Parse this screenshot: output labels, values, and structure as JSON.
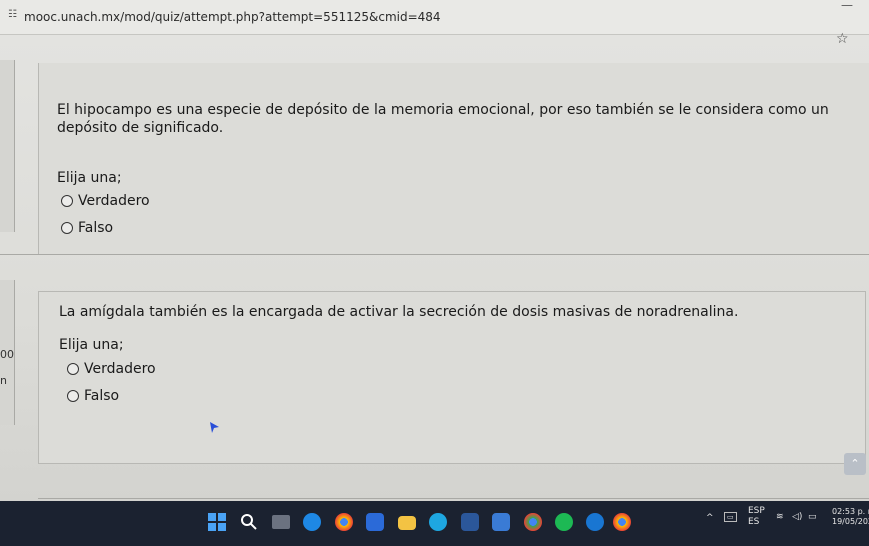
{
  "browser": {
    "url": "mooc.unach.mx/mod/quiz/attempt.php?attempt=551125&cmid=484"
  },
  "questions": [
    {
      "text": "El hipocampo es una especie de depósito de la memoria emocional, por eso también se le considera como un depósito de significado.",
      "prompt": "Elija una;",
      "options": [
        "Verdadero",
        "Falso"
      ]
    },
    {
      "text": "La amígdala también es la encargada de activar la secreción de dosis masivas de noradrenalina.",
      "prompt": "Elija una;",
      "options": [
        "Verdadero",
        "Falso"
      ]
    }
  ],
  "sidebar_fragments": [
    "00",
    "n"
  ],
  "taskbar": {
    "language_top": "ESP",
    "language_bottom": "ES",
    "time": "02:53 p. m.",
    "date": "19/05/2024",
    "icons": [
      "start-icon",
      "search-icon",
      "task-view-icon",
      "edge-icon",
      "chrome-icon",
      "mail-icon",
      "file-explorer-icon",
      "skype-icon",
      "word-icon",
      "store-icon",
      "chrome-icon",
      "spotify-icon",
      "cortana-icon",
      "chrome-icon"
    ]
  },
  "colors": {
    "taskbar": "#1b2230",
    "page_background": "#dcdcd8"
  }
}
